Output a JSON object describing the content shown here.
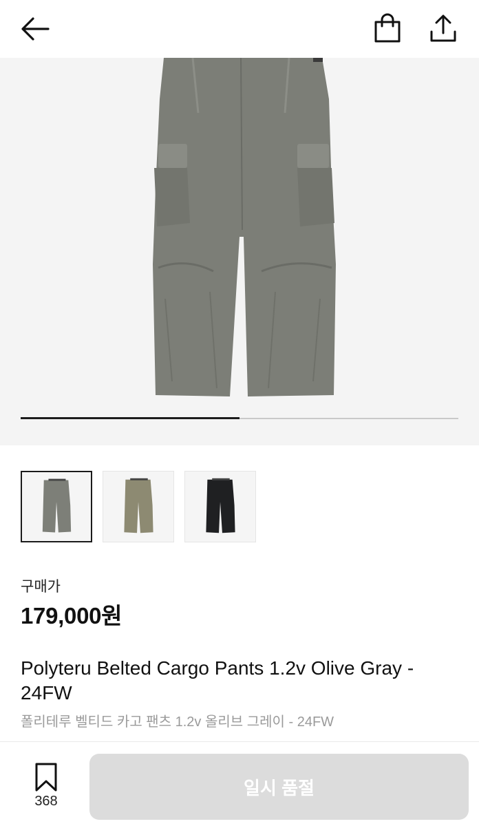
{
  "header": {
    "icons": [
      "back-arrow-icon",
      "shopping-bag-icon",
      "share-icon"
    ]
  },
  "gallery": {
    "current_image_fraction": 0.5,
    "thumbnails": [
      {
        "color": "#7d7f78",
        "selected": true
      },
      {
        "color": "#8d8a72",
        "selected": false
      },
      {
        "color": "#1f2022",
        "selected": false
      }
    ]
  },
  "product": {
    "price_label": "구매가",
    "price": "179,000원",
    "name_en": "Polyteru Belted Cargo Pants 1.2v Olive Gray - 24FW",
    "name_ko": "폴리테루 벨티드 카고 팬츠 1.2v 올리브 그레이 - 24FW"
  },
  "footer": {
    "bookmark_count": "368",
    "action_label": "일시 품절",
    "action_color": "#dcdcdc"
  }
}
